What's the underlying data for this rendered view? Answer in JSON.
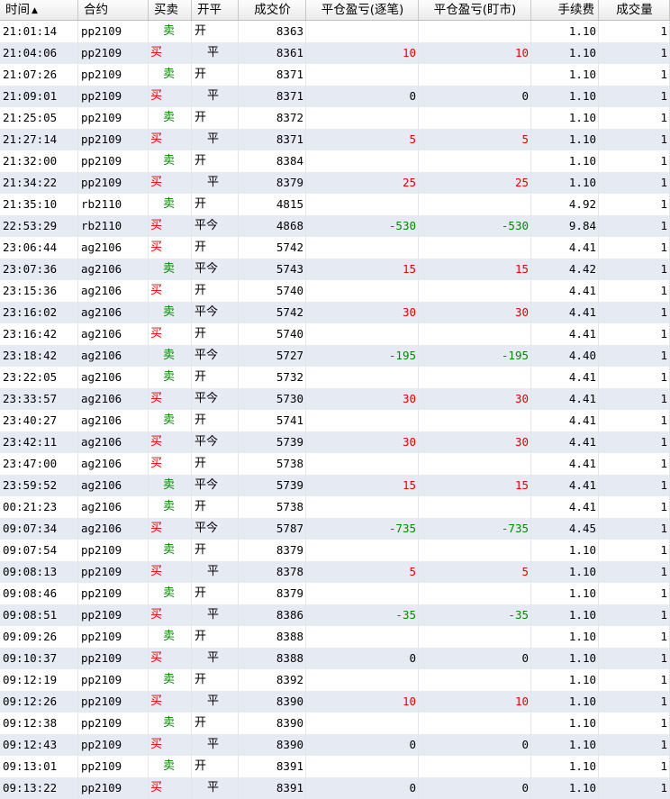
{
  "header": {
    "time": "时间",
    "time_sort_icon": "▲",
    "symbol": "合约",
    "buy_sell": "买卖",
    "open_close": "开平",
    "price": "成交价",
    "pnl_by_trade": "平仓盈亏(逐笔)",
    "pnl_mark": "平仓盈亏(盯市)",
    "fee": "手续费",
    "volume": "成交量"
  },
  "colors": {
    "buy": "#e00000",
    "sell": "#008800",
    "profit": "#e00000",
    "loss": "#008800",
    "alt_row": "#e6ebf3"
  },
  "rows": [
    {
      "time": "21:01:14",
      "symbol": "pp2109",
      "side": "卖",
      "oc": "开",
      "price": "8363",
      "pnl1": "",
      "pnl2": "",
      "fee": "1.10",
      "vol": "1"
    },
    {
      "time": "21:04:06",
      "symbol": "pp2109",
      "side": "买",
      "oc": "平",
      "price": "8361",
      "pnl1": "10",
      "pnl2": "10",
      "fee": "1.10",
      "vol": "1"
    },
    {
      "time": "21:07:26",
      "symbol": "pp2109",
      "side": "卖",
      "oc": "开",
      "price": "8371",
      "pnl1": "",
      "pnl2": "",
      "fee": "1.10",
      "vol": "1"
    },
    {
      "time": "21:09:01",
      "symbol": "pp2109",
      "side": "买",
      "oc": "平",
      "price": "8371",
      "pnl1": "0",
      "pnl2": "0",
      "fee": "1.10",
      "vol": "1"
    },
    {
      "time": "21:25:05",
      "symbol": "pp2109",
      "side": "卖",
      "oc": "开",
      "price": "8372",
      "pnl1": "",
      "pnl2": "",
      "fee": "1.10",
      "vol": "1"
    },
    {
      "time": "21:27:14",
      "symbol": "pp2109",
      "side": "买",
      "oc": "平",
      "price": "8371",
      "pnl1": "5",
      "pnl2": "5",
      "fee": "1.10",
      "vol": "1"
    },
    {
      "time": "21:32:00",
      "symbol": "pp2109",
      "side": "卖",
      "oc": "开",
      "price": "8384",
      "pnl1": "",
      "pnl2": "",
      "fee": "1.10",
      "vol": "1"
    },
    {
      "time": "21:34:22",
      "symbol": "pp2109",
      "side": "买",
      "oc": "平",
      "price": "8379",
      "pnl1": "25",
      "pnl2": "25",
      "fee": "1.10",
      "vol": "1"
    },
    {
      "time": "21:35:10",
      "symbol": "rb2110",
      "side": "卖",
      "oc": "开",
      "price": "4815",
      "pnl1": "",
      "pnl2": "",
      "fee": "4.92",
      "vol": "1"
    },
    {
      "time": "22:53:29",
      "symbol": "rb2110",
      "side": "买",
      "oc": "平今",
      "price": "4868",
      "pnl1": "-530",
      "pnl2": "-530",
      "fee": "9.84",
      "vol": "1"
    },
    {
      "time": "23:06:44",
      "symbol": "ag2106",
      "side": "买",
      "oc": "开",
      "price": "5742",
      "pnl1": "",
      "pnl2": "",
      "fee": "4.41",
      "vol": "1"
    },
    {
      "time": "23:07:36",
      "symbol": "ag2106",
      "side": "卖",
      "oc": "平今",
      "price": "5743",
      "pnl1": "15",
      "pnl2": "15",
      "fee": "4.42",
      "vol": "1"
    },
    {
      "time": "23:15:36",
      "symbol": "ag2106",
      "side": "买",
      "oc": "开",
      "price": "5740",
      "pnl1": "",
      "pnl2": "",
      "fee": "4.41",
      "vol": "1"
    },
    {
      "time": "23:16:02",
      "symbol": "ag2106",
      "side": "卖",
      "oc": "平今",
      "price": "5742",
      "pnl1": "30",
      "pnl2": "30",
      "fee": "4.41",
      "vol": "1"
    },
    {
      "time": "23:16:42",
      "symbol": "ag2106",
      "side": "买",
      "oc": "开",
      "price": "5740",
      "pnl1": "",
      "pnl2": "",
      "fee": "4.41",
      "vol": "1"
    },
    {
      "time": "23:18:42",
      "symbol": "ag2106",
      "side": "卖",
      "oc": "平今",
      "price": "5727",
      "pnl1": "-195",
      "pnl2": "-195",
      "fee": "4.40",
      "vol": "1"
    },
    {
      "time": "23:22:05",
      "symbol": "ag2106",
      "side": "卖",
      "oc": "开",
      "price": "5732",
      "pnl1": "",
      "pnl2": "",
      "fee": "4.41",
      "vol": "1"
    },
    {
      "time": "23:33:57",
      "symbol": "ag2106",
      "side": "买",
      "oc": "平今",
      "price": "5730",
      "pnl1": "30",
      "pnl2": "30",
      "fee": "4.41",
      "vol": "1"
    },
    {
      "time": "23:40:27",
      "symbol": "ag2106",
      "side": "卖",
      "oc": "开",
      "price": "5741",
      "pnl1": "",
      "pnl2": "",
      "fee": "4.41",
      "vol": "1"
    },
    {
      "time": "23:42:11",
      "symbol": "ag2106",
      "side": "买",
      "oc": "平今",
      "price": "5739",
      "pnl1": "30",
      "pnl2": "30",
      "fee": "4.41",
      "vol": "1"
    },
    {
      "time": "23:47:00",
      "symbol": "ag2106",
      "side": "买",
      "oc": "开",
      "price": "5738",
      "pnl1": "",
      "pnl2": "",
      "fee": "4.41",
      "vol": "1"
    },
    {
      "time": "23:59:52",
      "symbol": "ag2106",
      "side": "卖",
      "oc": "平今",
      "price": "5739",
      "pnl1": "15",
      "pnl2": "15",
      "fee": "4.41",
      "vol": "1"
    },
    {
      "time": "00:21:23",
      "symbol": "ag2106",
      "side": "卖",
      "oc": "开",
      "price": "5738",
      "pnl1": "",
      "pnl2": "",
      "fee": "4.41",
      "vol": "1"
    },
    {
      "time": "09:07:34",
      "symbol": "ag2106",
      "side": "买",
      "oc": "平今",
      "price": "5787",
      "pnl1": "-735",
      "pnl2": "-735",
      "fee": "4.45",
      "vol": "1"
    },
    {
      "time": "09:07:54",
      "symbol": "pp2109",
      "side": "卖",
      "oc": "开",
      "price": "8379",
      "pnl1": "",
      "pnl2": "",
      "fee": "1.10",
      "vol": "1"
    },
    {
      "time": "09:08:13",
      "symbol": "pp2109",
      "side": "买",
      "oc": "平",
      "price": "8378",
      "pnl1": "5",
      "pnl2": "5",
      "fee": "1.10",
      "vol": "1"
    },
    {
      "time": "09:08:46",
      "symbol": "pp2109",
      "side": "卖",
      "oc": "开",
      "price": "8379",
      "pnl1": "",
      "pnl2": "",
      "fee": "1.10",
      "vol": "1"
    },
    {
      "time": "09:08:51",
      "symbol": "pp2109",
      "side": "买",
      "oc": "平",
      "price": "8386",
      "pnl1": "-35",
      "pnl2": "-35",
      "fee": "1.10",
      "vol": "1"
    },
    {
      "time": "09:09:26",
      "symbol": "pp2109",
      "side": "卖",
      "oc": "开",
      "price": "8388",
      "pnl1": "",
      "pnl2": "",
      "fee": "1.10",
      "vol": "1"
    },
    {
      "time": "09:10:37",
      "symbol": "pp2109",
      "side": "买",
      "oc": "平",
      "price": "8388",
      "pnl1": "0",
      "pnl2": "0",
      "fee": "1.10",
      "vol": "1"
    },
    {
      "time": "09:12:19",
      "symbol": "pp2109",
      "side": "卖",
      "oc": "开",
      "price": "8392",
      "pnl1": "",
      "pnl2": "",
      "fee": "1.10",
      "vol": "1"
    },
    {
      "time": "09:12:26",
      "symbol": "pp2109",
      "side": "买",
      "oc": "平",
      "price": "8390",
      "pnl1": "10",
      "pnl2": "10",
      "fee": "1.10",
      "vol": "1"
    },
    {
      "time": "09:12:38",
      "symbol": "pp2109",
      "side": "卖",
      "oc": "开",
      "price": "8390",
      "pnl1": "",
      "pnl2": "",
      "fee": "1.10",
      "vol": "1"
    },
    {
      "time": "09:12:43",
      "symbol": "pp2109",
      "side": "买",
      "oc": "平",
      "price": "8390",
      "pnl1": "0",
      "pnl2": "0",
      "fee": "1.10",
      "vol": "1"
    },
    {
      "time": "09:13:01",
      "symbol": "pp2109",
      "side": "卖",
      "oc": "开",
      "price": "8391",
      "pnl1": "",
      "pnl2": "",
      "fee": "1.10",
      "vol": "1"
    },
    {
      "time": "09:13:22",
      "symbol": "pp2109",
      "side": "买",
      "oc": "平",
      "price": "8391",
      "pnl1": "0",
      "pnl2": "0",
      "fee": "1.10",
      "vol": "1"
    }
  ]
}
